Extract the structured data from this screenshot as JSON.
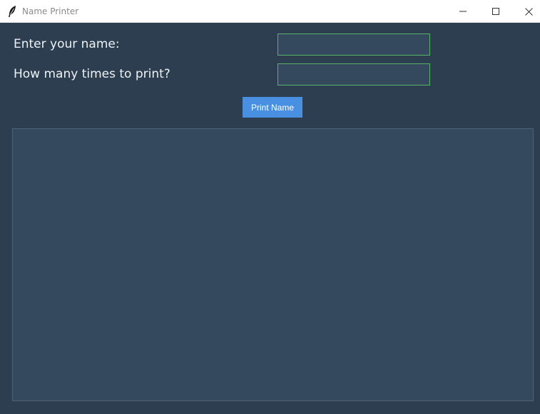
{
  "window": {
    "title": "Name Printer",
    "app_icon": "feather-icon",
    "controls": {
      "minimize_icon": "minimize-icon",
      "maximize_icon": "maximize-icon",
      "close_icon": "close-icon"
    }
  },
  "form": {
    "name_label": "Enter your name:",
    "name_value": "",
    "count_label": "How many times to print?",
    "count_value": "",
    "print_button_label": "Print Name"
  },
  "output": {
    "text": ""
  },
  "colors": {
    "background": "#2c3e50",
    "field_background": "#34495e",
    "field_border": "#58b368",
    "button": "#4a90e2",
    "text": "#eef2f5"
  }
}
